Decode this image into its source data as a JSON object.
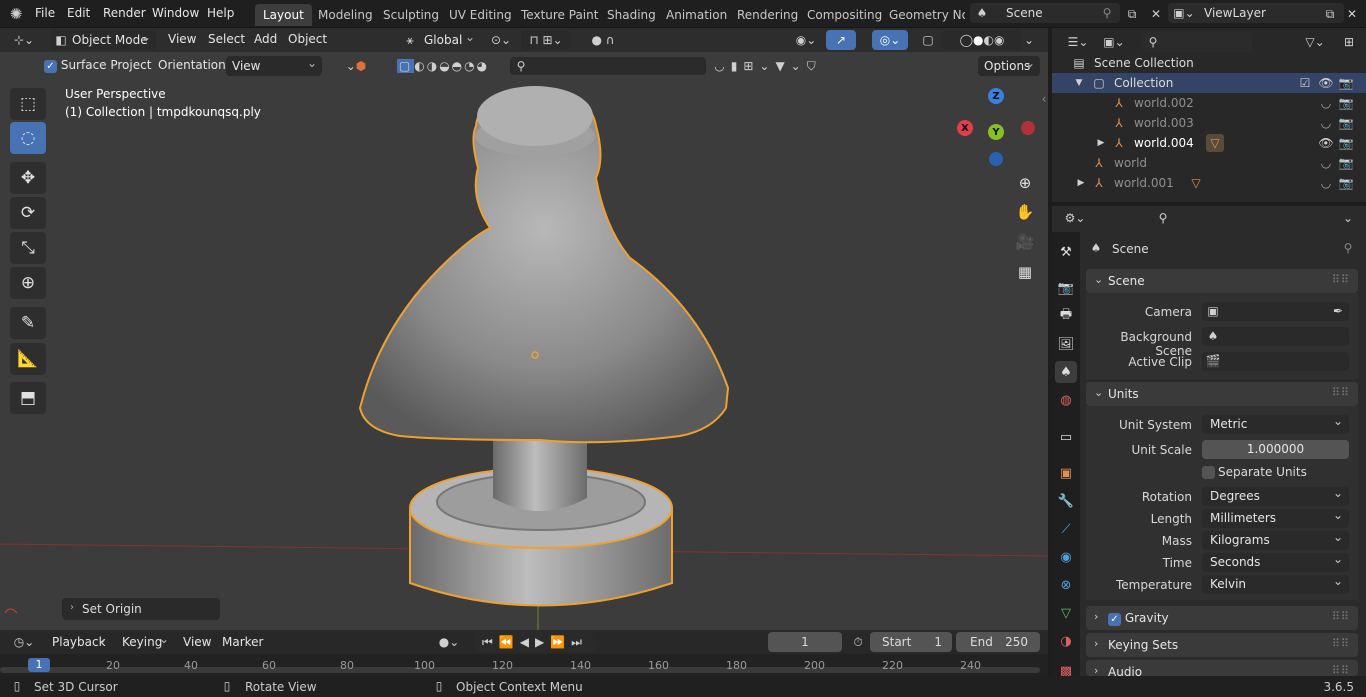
{
  "menu": {
    "file": "File",
    "edit": "Edit",
    "render": "Render",
    "window": "Window",
    "help": "Help"
  },
  "workspaces": [
    "Layout",
    "Modeling",
    "Sculpting",
    "UV Editing",
    "Texture Paint",
    "Shading",
    "Animation",
    "Rendering",
    "Compositing",
    "Geometry Noc"
  ],
  "scene_name": "Scene",
  "view_layer": "ViewLayer",
  "viewport": {
    "mode": "Object Mode",
    "menus": [
      "View",
      "Select",
      "Add",
      "Object"
    ],
    "transform_orientation": "Global",
    "surface_project": "Surface Project",
    "orientation_label": "Orientation:",
    "orientation_value": "View",
    "options": "Options",
    "perspective": "User Perspective",
    "object_info": "(1) Collection | tmpdkounqsq.ply",
    "last_op": "Set Origin"
  },
  "gizmo": {
    "z": "Z",
    "y": "Y",
    "x": "X"
  },
  "outliner": {
    "scene_collection": "Scene Collection",
    "collection": "Collection",
    "items": [
      "world.002",
      "world.003",
      "world.004",
      "world",
      "world.001"
    ]
  },
  "properties": {
    "header": "Scene",
    "scene_panel": "Scene",
    "camera_label": "Camera",
    "background_label": "Background Scene",
    "clip_label": "Active Clip",
    "units_panel": "Units",
    "unit_system_label": "Unit System",
    "unit_system": "Metric",
    "unit_scale_label": "Unit Scale",
    "unit_scale": "1.000000",
    "separate_units": "Separate Units",
    "rotation_label": "Rotation",
    "rotation": "Degrees",
    "length_label": "Length",
    "length": "Millimeters",
    "mass_label": "Mass",
    "mass": "Kilograms",
    "time_label": "Time",
    "time": "Seconds",
    "temperature_label": "Temperature",
    "temperature": "Kelvin",
    "gravity": "Gravity",
    "keying_sets": "Keying Sets",
    "audio": "Audio"
  },
  "timeline": {
    "playback": "Playback",
    "keying": "Keying",
    "view": "View",
    "marker": "Marker",
    "current_frame": "1",
    "start_label": "Start",
    "start": "1",
    "end_label": "End",
    "end": "250",
    "ticks": [
      "1",
      "20",
      "40",
      "60",
      "80",
      "100",
      "120",
      "140",
      "160",
      "180",
      "200",
      "220",
      "240"
    ]
  },
  "status": {
    "left": "Set 3D Cursor",
    "mid": "Rotate View",
    "right": "Object Context Menu",
    "version": "3.6.5"
  },
  "colors": {
    "accent": "#4772b3",
    "selection": "#f0a030",
    "x_axis": "#e0404a",
    "y_axis": "#88c020",
    "z_axis": "#3a80e0"
  }
}
